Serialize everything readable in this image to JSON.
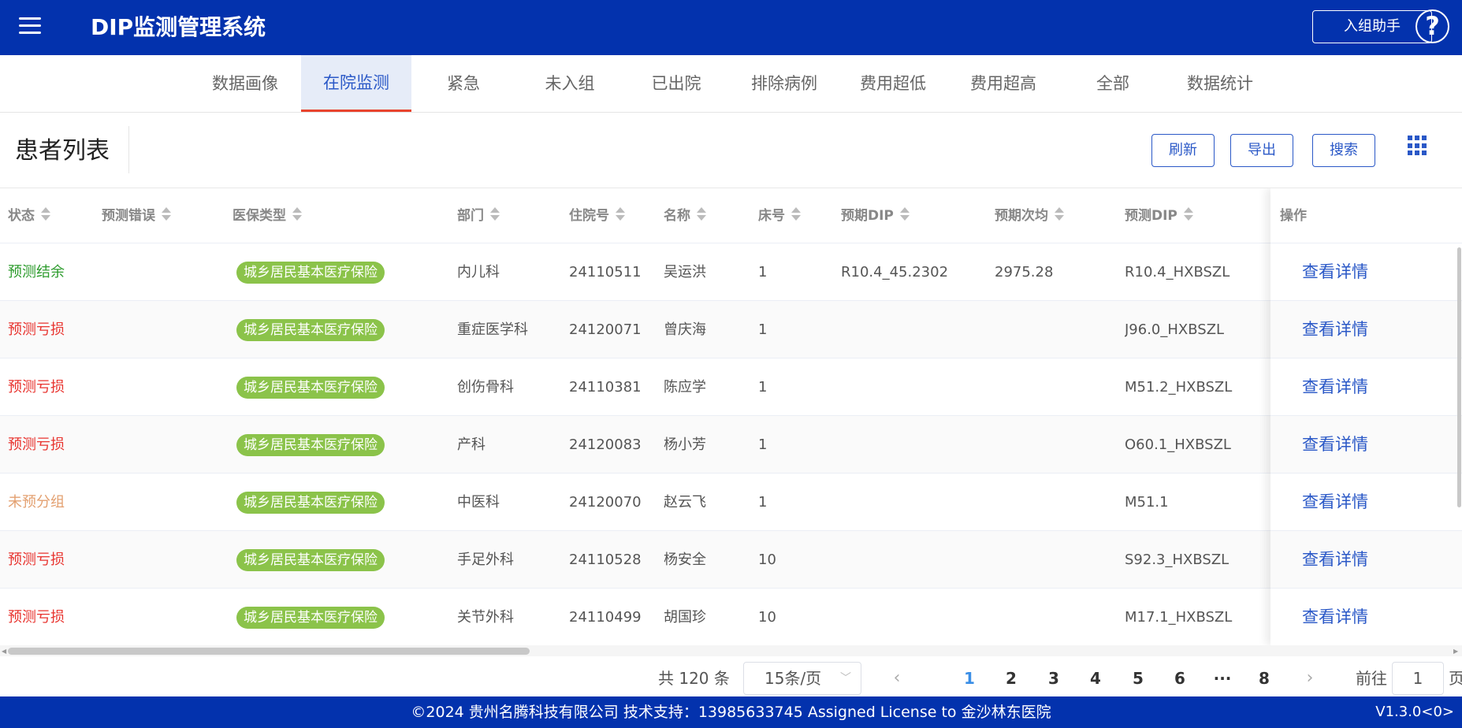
{
  "header": {
    "title": "DIP监测管理系统",
    "assist_label": "入组助手",
    "help_glyph": "?"
  },
  "tabs": [
    {
      "label": "数据画像",
      "active": false
    },
    {
      "label": "在院监测",
      "active": true
    },
    {
      "label": "紧急",
      "active": false
    },
    {
      "label": "未入组",
      "active": false
    },
    {
      "label": "已出院",
      "active": false
    },
    {
      "label": "排除病例",
      "active": false
    },
    {
      "label": "费用超低",
      "active": false
    },
    {
      "label": "费用超高",
      "active": false
    },
    {
      "label": "全部",
      "active": false
    },
    {
      "label": "数据统计",
      "active": false
    }
  ],
  "toolbar": {
    "heading": "患者列表",
    "refresh_label": "刷新",
    "export_label": "导出",
    "search_label": "搜索"
  },
  "table": {
    "columns": [
      "状态",
      "预测错误",
      "医保类型",
      "部门",
      "住院号",
      "名称",
      "床号",
      "预期DIP",
      "预期次均",
      "预测DIP"
    ],
    "action_header": "操作",
    "action_label": "查看详情",
    "rows": [
      {
        "status": "预测结余",
        "status_type": "ok",
        "error": "",
        "insurance": "城乡居民基本医疗保险",
        "dept": "内儿科",
        "admission_no": "24110511",
        "name": "吴运洪",
        "bed": "1",
        "expected_dip": "R10.4_45.2302",
        "expected_avg": "2975.28",
        "predicted_dip": "R10.4_HXBSZL"
      },
      {
        "status": "预测亏损",
        "status_type": "loss",
        "error": "",
        "insurance": "城乡居民基本医疗保险",
        "dept": "重症医学科",
        "admission_no": "24120071",
        "name": "曾庆海",
        "bed": "1",
        "expected_dip": "",
        "expected_avg": "",
        "predicted_dip": "J96.0_HXBSZL"
      },
      {
        "status": "预测亏损",
        "status_type": "loss",
        "error": "",
        "insurance": "城乡居民基本医疗保险",
        "dept": "创伤骨科",
        "admission_no": "24110381",
        "name": "陈应学",
        "bed": "1",
        "expected_dip": "",
        "expected_avg": "",
        "predicted_dip": "M51.2_HXBSZL"
      },
      {
        "status": "预测亏损",
        "status_type": "loss",
        "error": "",
        "insurance": "城乡居民基本医疗保险",
        "dept": "产科",
        "admission_no": "24120083",
        "name": "杨小芳",
        "bed": "1",
        "expected_dip": "",
        "expected_avg": "",
        "predicted_dip": "O60.1_HXBSZL"
      },
      {
        "status": "未预分组",
        "status_type": "none",
        "error": "",
        "insurance": "城乡居民基本医疗保险",
        "dept": "中医科",
        "admission_no": "24120070",
        "name": "赵云飞",
        "bed": "1",
        "expected_dip": "",
        "expected_avg": "",
        "predicted_dip": "M51.1"
      },
      {
        "status": "预测亏损",
        "status_type": "loss",
        "error": "",
        "insurance": "城乡居民基本医疗保险",
        "dept": "手足外科",
        "admission_no": "24110528",
        "name": "杨安全",
        "bed": "10",
        "expected_dip": "",
        "expected_avg": "",
        "predicted_dip": "S92.3_HXBSZL"
      },
      {
        "status": "预测亏损",
        "status_type": "loss",
        "error": "",
        "insurance": "城乡居民基本医疗保险",
        "dept": "关节外科",
        "admission_no": "24110499",
        "name": "胡国珍",
        "bed": "10",
        "expected_dip": "",
        "expected_avg": "",
        "predicted_dip": "M17.1_HXBSZL"
      }
    ]
  },
  "pagination": {
    "total_text": "共 120 条",
    "page_size": "15条/页",
    "prev_glyph": "‹",
    "next_glyph": "›",
    "pages": [
      "1",
      "2",
      "3",
      "4",
      "5",
      "6",
      "···",
      "8"
    ],
    "current_page": "1",
    "goto_label": "前往",
    "goto_value": "1",
    "goto_suffix": "页"
  },
  "footer": {
    "copyright": "©2024 贵州名腾科技有限公司 技术支持：13985633745 Assigned License to 金沙林东医院",
    "version": "V1.3.0<0>"
  },
  "colors": {
    "brand": "#0332ad",
    "accent": "#2a58c7",
    "status_ok": "#2c9b2c",
    "status_loss": "#e8332e",
    "status_none": "#e3a070",
    "insurance_badge": "#8bc34a"
  }
}
